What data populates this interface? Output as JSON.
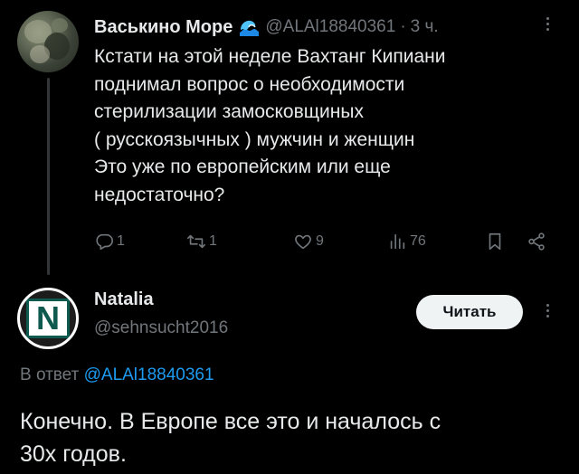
{
  "original_tweet": {
    "author_name": "Васькино Море",
    "handle": "@ALAl18840361",
    "separator": "·",
    "time": "3 ч.",
    "text_lines": [
      "Кстати на этой неделе Вахтанг Кипиани",
      "поднимал вопрос о необходимости",
      "стерилизации замосковщиных",
      "( русскоязычных ) мужчин и женщин",
      "Это уже по европейским или еще",
      "недостаточно?"
    ],
    "actions": {
      "replies": "1",
      "reposts": "1",
      "likes": "9",
      "views": "76"
    },
    "icons": [
      "wave-icon",
      "reply-icon",
      "repost-icon",
      "like-icon",
      "views-icon",
      "bookmark-icon",
      "share-icon",
      "more-icon"
    ]
  },
  "reply_tweet": {
    "author_name": "Natalia",
    "handle": "@sehnsucht2016",
    "avatar_letter": "N",
    "read_button": "Читать",
    "reply_prefix": "В ответ",
    "reply_to_handle": "@ALAl18840361",
    "text_lines": [
      "Конечно. В Европе все это и началось с",
      "30х годов."
    ]
  },
  "colors": {
    "background": "#000000",
    "text_primary": "#e7e9ea",
    "text_secondary": "#71767b",
    "link": "#1d9bf0",
    "button_bg": "#eff3f4"
  }
}
